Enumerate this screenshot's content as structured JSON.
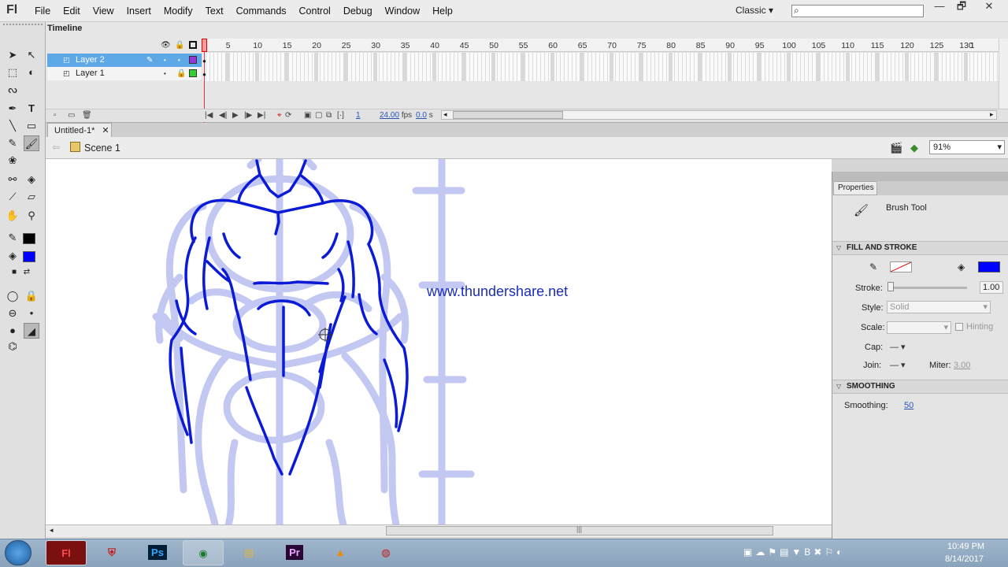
{
  "app": {
    "logo": "Fl",
    "menu": [
      "File",
      "Edit",
      "View",
      "Insert",
      "Modify",
      "Text",
      "Commands",
      "Control",
      "Debug",
      "Window",
      "Help"
    ],
    "workspace": "Classic",
    "window_controls": [
      "—",
      "🗗",
      "✕"
    ]
  },
  "timeline": {
    "tab": "Timeline",
    "ruler_marks": [
      "1",
      "5",
      "10",
      "15",
      "20",
      "25",
      "30",
      "35",
      "40",
      "45",
      "50",
      "55",
      "60",
      "65",
      "70",
      "75",
      "80",
      "85",
      "90",
      "95",
      "100",
      "105",
      "110",
      "115",
      "120",
      "125",
      "130",
      "1"
    ],
    "layers": [
      {
        "name": "Layer 2",
        "selected": true,
        "color": "#9a35d9"
      },
      {
        "name": "Layer 1",
        "selected": false,
        "color": "#32d132"
      }
    ],
    "current_frame": "1",
    "fps": "24.00",
    "fps_unit": "fps",
    "time": "0.0",
    "time_unit": "s"
  },
  "document": {
    "tab": "Untitled-1*",
    "scene": "Scene 1",
    "zoom": "91%"
  },
  "stage": {
    "watermark": "www.thundershare.net",
    "sketch_color": "#0b1ad6",
    "guide_color": "#c3c8f2"
  },
  "properties": {
    "tab": "Properties",
    "tool_name": "Brush Tool",
    "fill_stroke": {
      "title": "FILL AND STROKE",
      "stroke_label": "Stroke:",
      "stroke_value": "1.00",
      "style_label": "Style:",
      "style_value": "Solid",
      "scale_label": "Scale:",
      "hinting_label": "Hinting",
      "cap_label": "Cap:",
      "join_label": "Join:",
      "miter_label": "Miter:",
      "miter_value": "3.00",
      "fill_color": "#0000ff"
    },
    "smoothing": {
      "title": "SMOOTHING",
      "label": "Smoothing:",
      "value": "50"
    }
  },
  "taskbar": {
    "time": "10:49 PM",
    "date": "8/14/2017"
  }
}
